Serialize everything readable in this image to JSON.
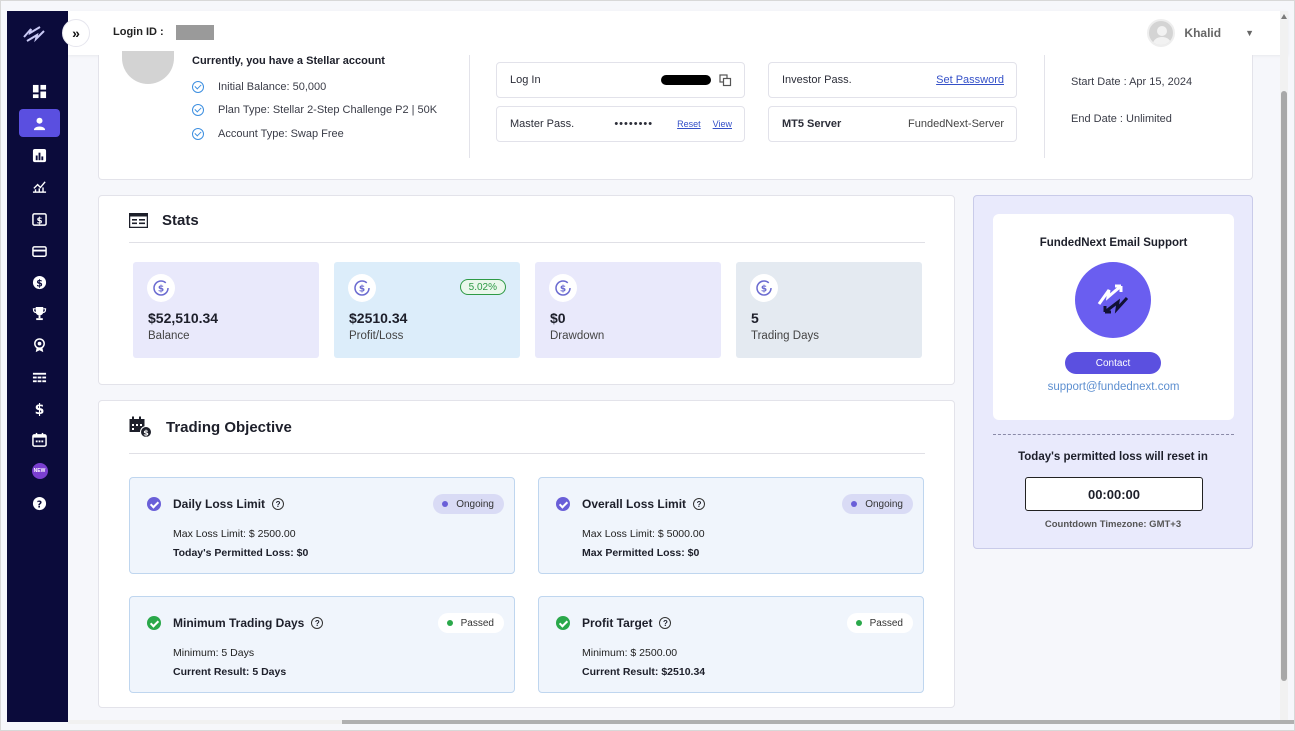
{
  "topbar": {
    "login_label": "Login ID :",
    "user_name": "Khalid"
  },
  "account": {
    "title": "Currently, you have a Stellar account",
    "items": [
      "Initial Balance: 50,000",
      "Plan Type: Stellar 2-Step Challenge P2 | 50K",
      "Account Type: Swap Free"
    ],
    "login_label": "Log In",
    "master_label": "Master Pass.",
    "master_value": "••••••••",
    "reset_link": "Reset",
    "view_link": "View",
    "investor_label": "Investor Pass.",
    "investor_link": "Set Password",
    "server_label": "MT5 Server",
    "server_value": "FundedNext-Server",
    "start_date": "Start Date : Apr 15, 2024",
    "end_date": "End Date : Unlimited"
  },
  "stats": {
    "title": "Stats",
    "cards": [
      {
        "value": "$52,510.34",
        "caption": "Balance",
        "bg": "#e9e9fb"
      },
      {
        "value": "$2510.34",
        "caption": "Profit/Loss",
        "bg": "#dcedfa",
        "badge": "5.02%"
      },
      {
        "value": "$0",
        "caption": "Drawdown",
        "bg": "#e9e9fb"
      },
      {
        "value": "5",
        "caption": "Trading Days",
        "bg": "#e4eaf1"
      }
    ]
  },
  "objective": {
    "title": "Trading Objective",
    "items": [
      {
        "name": "Daily Loss Limit",
        "status": "Ongoing",
        "line1": "Max Loss Limit: $ 2500.00",
        "line2": "Today's Permitted Loss: $0"
      },
      {
        "name": "Overall Loss Limit",
        "status": "Ongoing",
        "line1": "Max Loss Limit: $ 5000.00",
        "line2": "Max Permitted Loss: $0"
      },
      {
        "name": "Minimum Trading Days",
        "status": "Passed",
        "line1": "Minimum: 5 Days",
        "line2": "Current Result: 5 Days"
      },
      {
        "name": "Profit Target",
        "status": "Passed",
        "line1": "Minimum: $ 2500.00",
        "line2": "Current Result: $2510.34"
      }
    ]
  },
  "support": {
    "title": "FundedNext Email Support",
    "contact_label": "Contact",
    "email": "support@fundednext.com",
    "reset_text": "Today's permitted loss will reset in",
    "timer": "00:00:00",
    "timezone": "Countdown Timezone: GMT+3"
  },
  "sidebar": {
    "new_badge": "NEW",
    "icons": [
      "dashboard-icon",
      "user-icon",
      "bar-chart-icon",
      "line-chart-icon",
      "dollar-box-icon",
      "card-icon",
      "dollar-circle-icon",
      "trophy-icon",
      "award-icon",
      "table-icon",
      "dollar-icon",
      "calendar-icon",
      "new-icon",
      "help-icon"
    ]
  },
  "colors": {
    "sidebar": "#0b0b3b",
    "accent": "#5b50e0",
    "ongoing_dot": "#6a5fd8",
    "passed_dot": "#2aa84a"
  }
}
